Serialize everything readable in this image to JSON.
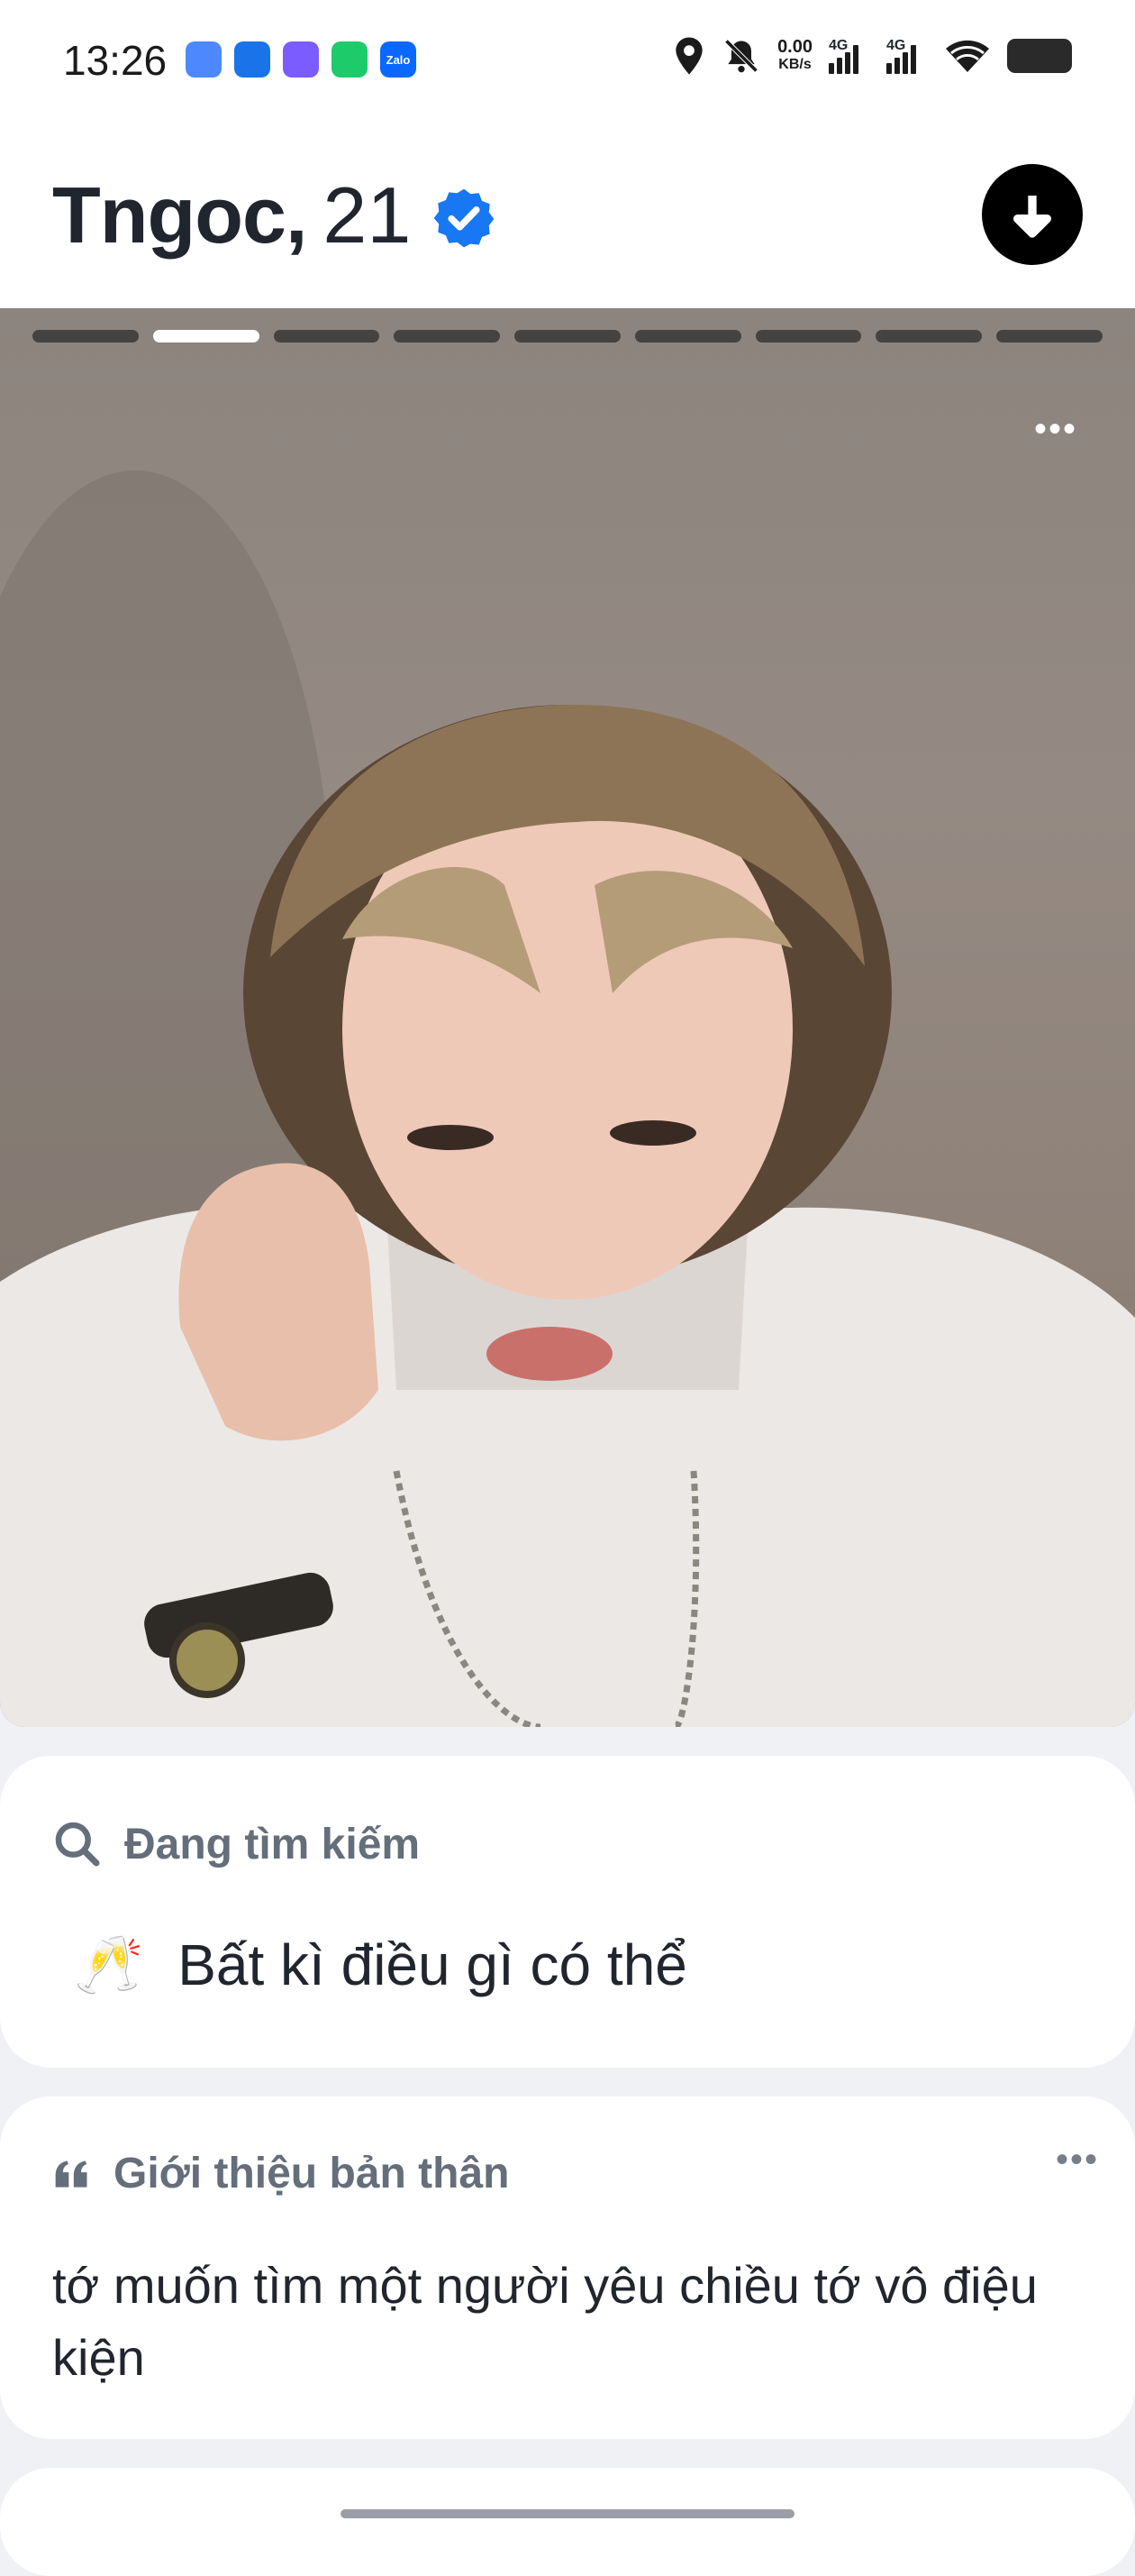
{
  "status_bar": {
    "time": "13:26",
    "notification_icons": [
      {
        "name": "files-app-icon",
        "color": "#4d88ff",
        "label": ""
      },
      {
        "name": "app-icon",
        "color": "#1a73e8",
        "label": ""
      },
      {
        "name": "chat-app-icon",
        "color": "#7a5cff",
        "label": ""
      },
      {
        "name": "phone-app-icon",
        "color": "#1ecb6b",
        "label": ""
      },
      {
        "name": "zalo-icon",
        "color": "#0b68ff",
        "label": "Zalo"
      }
    ],
    "net_speed_value": "0.00",
    "net_speed_unit": "KB/s",
    "sim1_label": "4G",
    "sim2_label": "4G"
  },
  "profile": {
    "name": "Tngoc,",
    "age": "21",
    "verified": true,
    "accent_color": "#1877f2"
  },
  "photos": {
    "count": 9,
    "active_index": 1
  },
  "looking_for": {
    "heading": "Đang tìm kiếm",
    "emoji": "🥂",
    "value": "Bất kì điều gì có thể"
  },
  "about": {
    "heading": "Giới thiệu bản thân",
    "text": "tớ muốn tìm một người yêu chiều tớ vô điệu kiện"
  }
}
